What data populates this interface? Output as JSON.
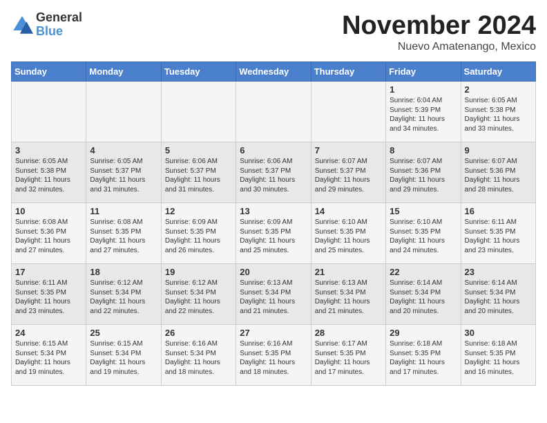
{
  "logo": {
    "general": "General",
    "blue": "Blue"
  },
  "header": {
    "month": "November 2024",
    "location": "Nuevo Amatenango, Mexico"
  },
  "days_of_week": [
    "Sunday",
    "Monday",
    "Tuesday",
    "Wednesday",
    "Thursday",
    "Friday",
    "Saturday"
  ],
  "weeks": [
    [
      {
        "day": "",
        "info": ""
      },
      {
        "day": "",
        "info": ""
      },
      {
        "day": "",
        "info": ""
      },
      {
        "day": "",
        "info": ""
      },
      {
        "day": "",
        "info": ""
      },
      {
        "day": "1",
        "info": "Sunrise: 6:04 AM\nSunset: 5:39 PM\nDaylight: 11 hours and 34 minutes."
      },
      {
        "day": "2",
        "info": "Sunrise: 6:05 AM\nSunset: 5:38 PM\nDaylight: 11 hours and 33 minutes."
      }
    ],
    [
      {
        "day": "3",
        "info": "Sunrise: 6:05 AM\nSunset: 5:38 PM\nDaylight: 11 hours and 32 minutes."
      },
      {
        "day": "4",
        "info": "Sunrise: 6:05 AM\nSunset: 5:37 PM\nDaylight: 11 hours and 31 minutes."
      },
      {
        "day": "5",
        "info": "Sunrise: 6:06 AM\nSunset: 5:37 PM\nDaylight: 11 hours and 31 minutes."
      },
      {
        "day": "6",
        "info": "Sunrise: 6:06 AM\nSunset: 5:37 PM\nDaylight: 11 hours and 30 minutes."
      },
      {
        "day": "7",
        "info": "Sunrise: 6:07 AM\nSunset: 5:37 PM\nDaylight: 11 hours and 29 minutes."
      },
      {
        "day": "8",
        "info": "Sunrise: 6:07 AM\nSunset: 5:36 PM\nDaylight: 11 hours and 29 minutes."
      },
      {
        "day": "9",
        "info": "Sunrise: 6:07 AM\nSunset: 5:36 PM\nDaylight: 11 hours and 28 minutes."
      }
    ],
    [
      {
        "day": "10",
        "info": "Sunrise: 6:08 AM\nSunset: 5:36 PM\nDaylight: 11 hours and 27 minutes."
      },
      {
        "day": "11",
        "info": "Sunrise: 6:08 AM\nSunset: 5:35 PM\nDaylight: 11 hours and 27 minutes."
      },
      {
        "day": "12",
        "info": "Sunrise: 6:09 AM\nSunset: 5:35 PM\nDaylight: 11 hours and 26 minutes."
      },
      {
        "day": "13",
        "info": "Sunrise: 6:09 AM\nSunset: 5:35 PM\nDaylight: 11 hours and 25 minutes."
      },
      {
        "day": "14",
        "info": "Sunrise: 6:10 AM\nSunset: 5:35 PM\nDaylight: 11 hours and 25 minutes."
      },
      {
        "day": "15",
        "info": "Sunrise: 6:10 AM\nSunset: 5:35 PM\nDaylight: 11 hours and 24 minutes."
      },
      {
        "day": "16",
        "info": "Sunrise: 6:11 AM\nSunset: 5:35 PM\nDaylight: 11 hours and 23 minutes."
      }
    ],
    [
      {
        "day": "17",
        "info": "Sunrise: 6:11 AM\nSunset: 5:35 PM\nDaylight: 11 hours and 23 minutes."
      },
      {
        "day": "18",
        "info": "Sunrise: 6:12 AM\nSunset: 5:34 PM\nDaylight: 11 hours and 22 minutes."
      },
      {
        "day": "19",
        "info": "Sunrise: 6:12 AM\nSunset: 5:34 PM\nDaylight: 11 hours and 22 minutes."
      },
      {
        "day": "20",
        "info": "Sunrise: 6:13 AM\nSunset: 5:34 PM\nDaylight: 11 hours and 21 minutes."
      },
      {
        "day": "21",
        "info": "Sunrise: 6:13 AM\nSunset: 5:34 PM\nDaylight: 11 hours and 21 minutes."
      },
      {
        "day": "22",
        "info": "Sunrise: 6:14 AM\nSunset: 5:34 PM\nDaylight: 11 hours and 20 minutes."
      },
      {
        "day": "23",
        "info": "Sunrise: 6:14 AM\nSunset: 5:34 PM\nDaylight: 11 hours and 20 minutes."
      }
    ],
    [
      {
        "day": "24",
        "info": "Sunrise: 6:15 AM\nSunset: 5:34 PM\nDaylight: 11 hours and 19 minutes."
      },
      {
        "day": "25",
        "info": "Sunrise: 6:15 AM\nSunset: 5:34 PM\nDaylight: 11 hours and 19 minutes."
      },
      {
        "day": "26",
        "info": "Sunrise: 6:16 AM\nSunset: 5:34 PM\nDaylight: 11 hours and 18 minutes."
      },
      {
        "day": "27",
        "info": "Sunrise: 6:16 AM\nSunset: 5:35 PM\nDaylight: 11 hours and 18 minutes."
      },
      {
        "day": "28",
        "info": "Sunrise: 6:17 AM\nSunset: 5:35 PM\nDaylight: 11 hours and 17 minutes."
      },
      {
        "day": "29",
        "info": "Sunrise: 6:18 AM\nSunset: 5:35 PM\nDaylight: 11 hours and 17 minutes."
      },
      {
        "day": "30",
        "info": "Sunrise: 6:18 AM\nSunset: 5:35 PM\nDaylight: 11 hours and 16 minutes."
      }
    ]
  ]
}
